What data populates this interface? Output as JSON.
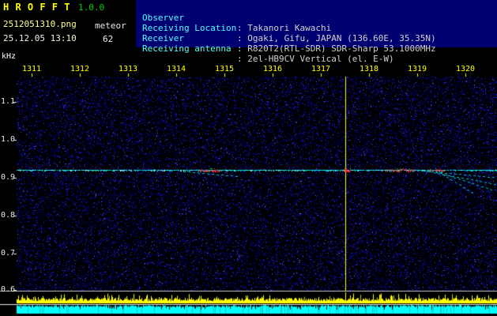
{
  "app": {
    "title": "H R O F F T",
    "version": "1.0.0",
    "filename": "2512051310.png",
    "mode": "meteor",
    "datetime": "25.12.05 13:10",
    "count": "62"
  },
  "station": {
    "rows": [
      {
        "label": "Observer",
        "value": ": Takanori Kawachi"
      },
      {
        "label": "Receiving Location",
        "value": ": Ogaki, Gifu, JAPAN (136.60E, 35.35N)"
      },
      {
        "label": "Receiver",
        "value": ": R820T2(RTL-SDR) SDR-Sharp 53.1000MHz"
      },
      {
        "label": "Receiving antenna",
        "value": ": 2el-HB9CV Vertical (el. E-W)"
      }
    ]
  },
  "chart_data": {
    "type": "heatmap",
    "subtype": "radio-meteor-spectrogram",
    "ylabel": "kHz",
    "x_ticks": [
      "1311",
      "1312",
      "1313",
      "1314",
      "1315",
      "1316",
      "1317",
      "1318",
      "1319",
      "1320"
    ],
    "y_ticks": [
      "1.1",
      "1.0",
      "0.9",
      "0.8",
      "0.7",
      "0.6"
    ],
    "x_range_hhmm": [
      1310.7,
      1320.65
    ],
    "y_range_khz": [
      0.6,
      1.17
    ],
    "grid": false,
    "carrier_khz": 0.92,
    "events": [
      {
        "kind": "strong-echo",
        "t_start": 1314.45,
        "t_end": 1314.9,
        "khz": 0.92
      },
      {
        "kind": "saturation",
        "t": 1317.51
      },
      {
        "kind": "strong-echo",
        "t_start": 1317.5,
        "t_end": 1317.62,
        "khz": 0.92
      },
      {
        "kind": "strong-echo",
        "t_start": 1318.35,
        "t_end": 1318.95,
        "khz": 0.92
      },
      {
        "kind": "strong-echo",
        "t_start": 1319.25,
        "t_end": 1319.55,
        "khz": 0.92
      },
      {
        "kind": "doppler-trail",
        "t_start": 1314.15,
        "khz_start": 0.916,
        "t_end": 1315.3,
        "khz_end": 0.903
      },
      {
        "kind": "doppler-trail",
        "t_start": 1318.9,
        "khz_start": 0.92,
        "t_end": 1320.65,
        "khz_end": 0.9
      },
      {
        "kind": "doppler-trail",
        "t_start": 1319.05,
        "khz_start": 0.92,
        "t_end": 1320.65,
        "khz_end": 0.882
      },
      {
        "kind": "doppler-trail",
        "t_start": 1319.3,
        "khz_start": 0.92,
        "t_end": 1320.6,
        "khz_end": 0.866
      },
      {
        "kind": "doppler-trail",
        "t_start": 1319.45,
        "khz_start": 0.915,
        "t_end": 1320.2,
        "khz_end": 0.856
      }
    ],
    "bottom_strips": [
      {
        "name": "signal-level-bar",
        "color": "#ffff00"
      },
      {
        "name": "detection-bar",
        "color": "#00ffff"
      }
    ]
  },
  "colors": {
    "bg": "#000000",
    "panel_blue": "#000070",
    "title_yellow": "#ffff00",
    "version_green": "#00cc00",
    "label_cyan": "#55ffff",
    "value_gray": "#d0d0d0",
    "tick_yellow": "#ffff00",
    "axis_white": "#e8e8e8",
    "noise_blue": "#2020d0",
    "carrier_cyan": "#00dcdc",
    "echo_red": "#ff3030",
    "echo_green": "#00cc44"
  }
}
